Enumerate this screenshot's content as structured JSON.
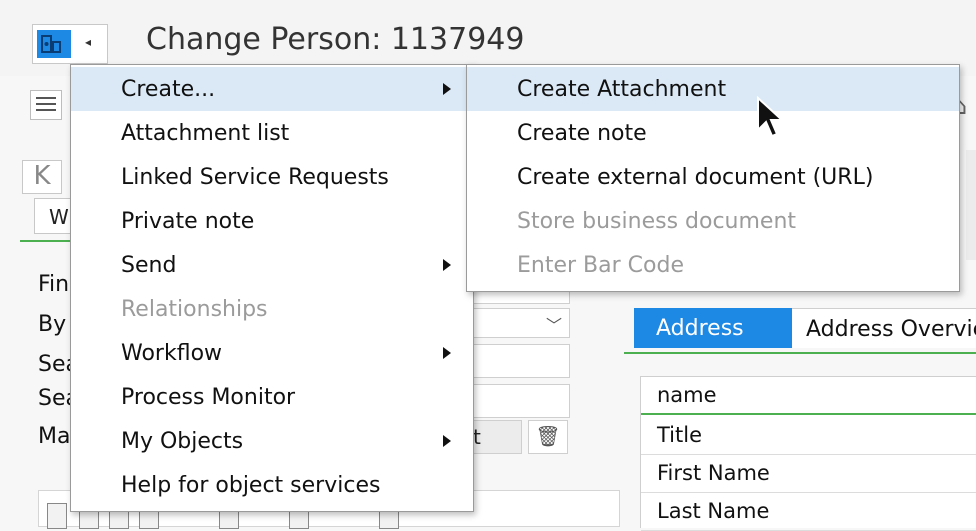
{
  "window": {
    "title": "Change Person: 1137949"
  },
  "main_menu": {
    "items": [
      {
        "label": "Create...",
        "submenu": true,
        "enabled": true,
        "highlighted": true
      },
      {
        "label": "Attachment list",
        "submenu": false,
        "enabled": true
      },
      {
        "label": "Linked Service Requests",
        "submenu": false,
        "enabled": true
      },
      {
        "label": "Private note",
        "submenu": false,
        "enabled": true
      },
      {
        "label": "Send",
        "submenu": true,
        "enabled": true
      },
      {
        "label": "Relationships",
        "submenu": false,
        "enabled": false
      },
      {
        "label": "Workflow",
        "submenu": true,
        "enabled": true
      },
      {
        "label": "Process Monitor",
        "submenu": false,
        "enabled": true
      },
      {
        "label": "My Objects",
        "submenu": true,
        "enabled": true
      },
      {
        "label": "Help for object services",
        "submenu": false,
        "enabled": true
      }
    ]
  },
  "sub_menu": {
    "items": [
      {
        "label": "Create Attachment",
        "enabled": true,
        "highlighted": true
      },
      {
        "label": "Create note",
        "enabled": true
      },
      {
        "label": "Create external document (URL)",
        "enabled": true
      },
      {
        "label": "Store business document",
        "enabled": false
      },
      {
        "label": "Enter Bar Code",
        "enabled": false
      }
    ]
  },
  "left_form": {
    "tab_fragment": "W",
    "labels": [
      "Fin",
      "By",
      "Sea",
      "Sea",
      "Ma"
    ],
    "find_button_fragment": "t"
  },
  "right_panel": {
    "tabs": [
      "Address",
      "Address Overvie"
    ],
    "rows": [
      "name",
      "Title",
      "First Name",
      "Last Name"
    ]
  },
  "colors": {
    "accent": "#1e88e5",
    "highlight": "#dbe9f7",
    "green_line": "#4caf50",
    "disabled_text": "#9b9b9b"
  }
}
